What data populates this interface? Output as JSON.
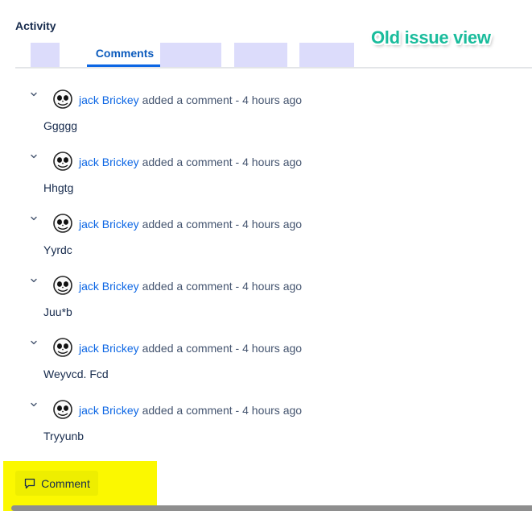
{
  "activity": {
    "heading": "Activity"
  },
  "tabs": {
    "comments_label": "Comments"
  },
  "annotation": {
    "label": "Old issue view"
  },
  "comments": [
    {
      "author": "jack Brickey",
      "action": "added a comment",
      "separator": "-",
      "time": "4 hours ago",
      "body": "Ggggg"
    },
    {
      "author": "jack Brickey",
      "action": "added a comment",
      "separator": "-",
      "time": "4 hours ago",
      "body": "Hhgtg"
    },
    {
      "author": "jack Brickey",
      "action": "added a comment",
      "separator": "-",
      "time": "4 hours ago",
      "body": "Yyrdc"
    },
    {
      "author": "jack Brickey",
      "action": "added a comment",
      "separator": "-",
      "time": "4 hours ago",
      "body": "Juu*b"
    },
    {
      "author": "jack Brickey",
      "action": "added a comment",
      "separator": "-",
      "time": "4 hours ago",
      "body": "Weyvcd. Fcd"
    },
    {
      "author": "jack Brickey",
      "action": "added a comment",
      "separator": "-",
      "time": "4 hours ago",
      "body": "Tryyunb"
    }
  ],
  "footer": {
    "comment_button_label": "Comment"
  },
  "colors": {
    "link": "#0c66e4",
    "tab_placeholder": "#dcdcfb",
    "highlight": "#fbf800",
    "annotation_text": "#1abc9c"
  },
  "icons": {
    "collapse": "chevron-down-icon",
    "avatar": "skull-avatar-icon",
    "comment": "speech-bubble-icon"
  }
}
